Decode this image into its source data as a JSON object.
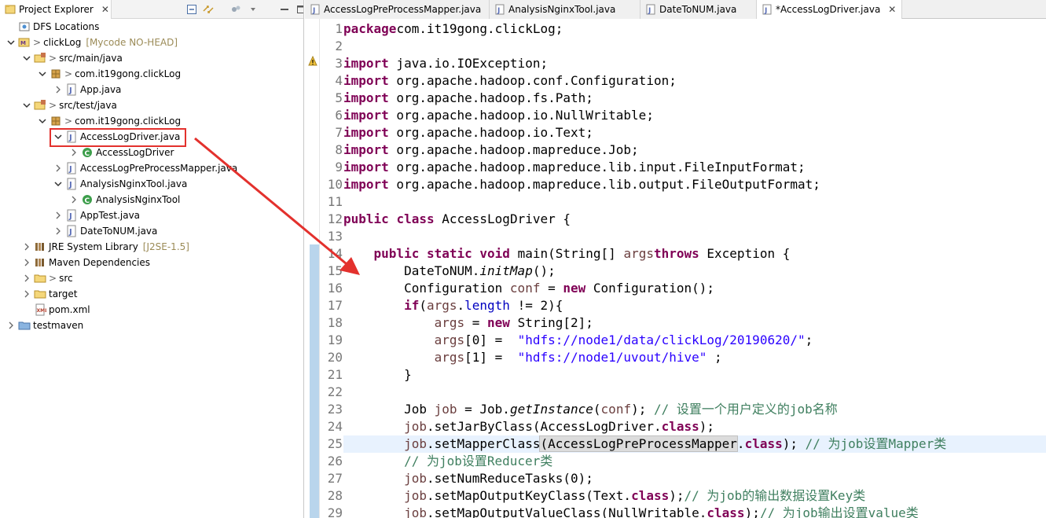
{
  "explorer": {
    "tab_title": "Project Explorer",
    "tab_close": "✕",
    "tree": [
      {
        "label": "DFS Locations",
        "icon": "dfs-locations-icon",
        "depth": 0,
        "arrow": "none"
      },
      {
        "label": "clickLog",
        "prefix": ">",
        "decoration": "[Mycode NO-HEAD]",
        "icon": "maven-project-icon",
        "depth": 0,
        "arrow": "down"
      },
      {
        "label": "src/main/java",
        "prefix": ">",
        "icon": "source-folder-icon",
        "depth": 1,
        "arrow": "down"
      },
      {
        "label": "com.it19gong.clickLog",
        "prefix": ">",
        "icon": "package-icon",
        "depth": 2,
        "arrow": "down"
      },
      {
        "label": "App.java",
        "icon": "java-file-icon",
        "depth": 3,
        "arrow": "right"
      },
      {
        "label": "src/test/java",
        "prefix": ">",
        "icon": "source-folder-icon",
        "depth": 1,
        "arrow": "down"
      },
      {
        "label": "com.it19gong.clickLog",
        "prefix": ">",
        "icon": "package-icon",
        "depth": 2,
        "arrow": "down"
      },
      {
        "label": "AccessLogDriver.java",
        "icon": "java-file-icon",
        "depth": 3,
        "arrow": "down",
        "selected": true
      },
      {
        "label": "AccessLogDriver",
        "icon": "class-icon",
        "depth": 4,
        "arrow": "right"
      },
      {
        "label": "AccessLogPreProcessMapper.java",
        "icon": "java-file-icon",
        "depth": 3,
        "arrow": "right"
      },
      {
        "label": "AnalysisNginxTool.java",
        "icon": "java-file-icon",
        "depth": 3,
        "arrow": "down"
      },
      {
        "label": "AnalysisNginxTool",
        "icon": "class-icon",
        "depth": 4,
        "arrow": "right"
      },
      {
        "label": "AppTest.java",
        "icon": "java-file-icon",
        "depth": 3,
        "arrow": "right"
      },
      {
        "label": "DateToNUM.java",
        "icon": "java-file-icon",
        "depth": 3,
        "arrow": "right"
      },
      {
        "label": "JRE System Library",
        "decoration": "[J2SE-1.5]",
        "icon": "library-icon",
        "depth": 1,
        "arrow": "right"
      },
      {
        "label": "Maven Dependencies",
        "icon": "library-icon",
        "depth": 1,
        "arrow": "right"
      },
      {
        "label": "src",
        "prefix": ">",
        "icon": "folder-icon",
        "depth": 1,
        "arrow": "right"
      },
      {
        "label": "target",
        "icon": "folder-icon",
        "depth": 1,
        "arrow": "right"
      },
      {
        "label": "pom.xml",
        "icon": "xml-file-icon",
        "depth": 1,
        "arrow": "none"
      },
      {
        "label": "testmaven",
        "icon": "project-icon",
        "depth": 0,
        "arrow": "right"
      }
    ]
  },
  "editor": {
    "tabs": [
      {
        "label": "AccessLogPreProcessMapper.java",
        "active": false
      },
      {
        "label": "AnalysisNginxTool.java",
        "active": false
      },
      {
        "label": "DateToNUM.java",
        "active": false
      },
      {
        "label": "*AccessLogDriver.java",
        "active": true
      }
    ],
    "tab_close": "✕",
    "lines": [
      {
        "n": "1",
        "tokens": [
          [
            "kw",
            "package"
          ],
          [
            "",
            "com.it19gong.clickLog;"
          ]
        ]
      },
      {
        "n": "2",
        "tokens": []
      },
      {
        "n": "3",
        "tokens": [
          [
            "kw",
            "import"
          ],
          [
            "",
            " java.io.IOException;"
          ]
        ]
      },
      {
        "n": "4",
        "tokens": [
          [
            "kw",
            "import"
          ],
          [
            "",
            " org.apache.hadoop.conf.Configuration;"
          ]
        ]
      },
      {
        "n": "5",
        "tokens": [
          [
            "kw",
            "import"
          ],
          [
            "",
            " org.apache.hadoop.fs.Path;"
          ]
        ]
      },
      {
        "n": "6",
        "tokens": [
          [
            "kw",
            "import"
          ],
          [
            "",
            " org.apache.hadoop.io.NullWritable;"
          ]
        ]
      },
      {
        "n": "7",
        "tokens": [
          [
            "kw",
            "import"
          ],
          [
            "",
            " org.apache.hadoop.io.Text;"
          ]
        ]
      },
      {
        "n": "8",
        "tokens": [
          [
            "kw",
            "import"
          ],
          [
            "",
            " org.apache.hadoop.mapreduce.Job;"
          ]
        ]
      },
      {
        "n": "9",
        "tokens": [
          [
            "kw",
            "import"
          ],
          [
            "",
            " org.apache.hadoop.mapreduce.lib.input.FileInputFormat;"
          ]
        ]
      },
      {
        "n": "10",
        "tokens": [
          [
            "kw",
            "import"
          ],
          [
            "",
            " org.apache.hadoop.mapreduce.lib.output.FileOutputFormat;"
          ]
        ]
      },
      {
        "n": "11",
        "tokens": []
      },
      {
        "n": "12",
        "tokens": [
          [
            "kw",
            "public"
          ],
          [
            "",
            " "
          ],
          [
            "kw",
            "class"
          ],
          [
            "",
            " AccessLogDriver {"
          ]
        ]
      },
      {
        "n": "13",
        "tokens": []
      },
      {
        "n": "14",
        "tokens": [
          [
            "",
            "    "
          ],
          [
            "kw",
            "public"
          ],
          [
            "",
            " "
          ],
          [
            "kw",
            "static"
          ],
          [
            "",
            " "
          ],
          [
            "kw",
            "void"
          ],
          [
            "",
            " main(String[] "
          ],
          [
            "var",
            "args"
          ],
          [
            ") "
          ],
          [
            "kw",
            "throws"
          ],
          [
            "",
            " Exception {"
          ]
        ]
      },
      {
        "n": "15",
        "tokens": [
          [
            "",
            "        DateToNUM."
          ],
          [
            "it",
            "initMap"
          ],
          [
            "",
            "();"
          ]
        ]
      },
      {
        "n": "16",
        "tokens": [
          [
            "",
            "        Configuration "
          ],
          [
            "var",
            "conf"
          ],
          [
            "",
            " = "
          ],
          [
            "kw",
            "new"
          ],
          [
            "",
            " Configuration();"
          ]
        ]
      },
      {
        "n": "17",
        "tokens": [
          [
            "",
            "        "
          ],
          [
            "kw",
            "if"
          ],
          [
            "",
            "("
          ],
          [
            "var",
            "args"
          ],
          [
            "",
            "."
          ],
          [
            "fld",
            "length"
          ],
          [
            "",
            " != 2){"
          ]
        ]
      },
      {
        "n": "18",
        "tokens": [
          [
            "",
            "            "
          ],
          [
            "var",
            "args"
          ],
          [
            "",
            " = "
          ],
          [
            "kw",
            "new"
          ],
          [
            "",
            " String[2];"
          ]
        ]
      },
      {
        "n": "19",
        "tokens": [
          [
            "",
            "            "
          ],
          [
            "var",
            "args"
          ],
          [
            "",
            "[0] =  "
          ],
          [
            "str",
            "\"hdfs://node1/data/clickLog/20190620/\""
          ],
          [
            "",
            ";"
          ]
        ]
      },
      {
        "n": "20",
        "tokens": [
          [
            "",
            "            "
          ],
          [
            "var",
            "args"
          ],
          [
            "",
            "[1] =  "
          ],
          [
            "str",
            "\"hdfs://node1/uvout/hive\""
          ],
          [
            "",
            " ;"
          ]
        ]
      },
      {
        "n": "21",
        "tokens": [
          [
            "",
            "        }"
          ]
        ]
      },
      {
        "n": "22",
        "tokens": []
      },
      {
        "n": "23",
        "tokens": [
          [
            "",
            "        Job "
          ],
          [
            "var",
            "job"
          ],
          [
            "",
            " = Job."
          ],
          [
            "it",
            "getInstance"
          ],
          [
            "",
            "("
          ],
          [
            "var",
            "conf"
          ],
          [
            "",
            "); "
          ],
          [
            "cm",
            "// 设置一个用户定义的job名称"
          ]
        ]
      },
      {
        "n": "24",
        "tokens": [
          [
            "",
            "        "
          ],
          [
            "var",
            "job"
          ],
          [
            "",
            ".setJarByClass(AccessLogDriver."
          ],
          [
            "kw",
            "class"
          ],
          [
            "",
            ");"
          ]
        ]
      },
      {
        "n": "25",
        "tokens": [
          [
            "",
            "        "
          ],
          [
            "var",
            "job"
          ],
          [
            "",
            ".setMapperClass"
          ],
          [
            "bh",
            "(AccessLogPreProcessMapper"
          ],
          [
            "",
            "."
          ],
          [
            "kw",
            "class"
          ],
          [
            "",
            "); "
          ],
          [
            "cm",
            "// 为job设置Mapper类"
          ]
        ],
        "highlight": true
      },
      {
        "n": "26",
        "tokens": [
          [
            "",
            "        "
          ],
          [
            "cm",
            "// 为job设置Reducer类"
          ]
        ]
      },
      {
        "n": "27",
        "tokens": [
          [
            "",
            "        "
          ],
          [
            "var",
            "job"
          ],
          [
            "",
            ".setNumReduceTasks(0);"
          ]
        ]
      },
      {
        "n": "28",
        "tokens": [
          [
            "",
            "        "
          ],
          [
            "var",
            "job"
          ],
          [
            "",
            ".setMapOutputKeyClass(Text."
          ],
          [
            "kw",
            "class"
          ],
          [
            "",
            ");"
          ],
          [
            "cm",
            "// 为job的输出数据设置Key类"
          ]
        ]
      },
      {
        "n": "29",
        "tokens": [
          [
            "",
            "        "
          ],
          [
            "var",
            "job"
          ],
          [
            "",
            ".setMapOutputValueClass(NullWritable."
          ],
          [
            "kw",
            "class"
          ],
          [
            "",
            ");"
          ],
          [
            "cm",
            "// 为job输出设置value类"
          ]
        ]
      }
    ]
  },
  "colors": {
    "keyword": "#7f0055",
    "string": "#2a00ff",
    "comment": "#3f7f5f",
    "local_var": "#6a3e3e",
    "field": "#0000c0",
    "annotation_red": "#e3312d",
    "current_line": "#e8f2fe"
  }
}
